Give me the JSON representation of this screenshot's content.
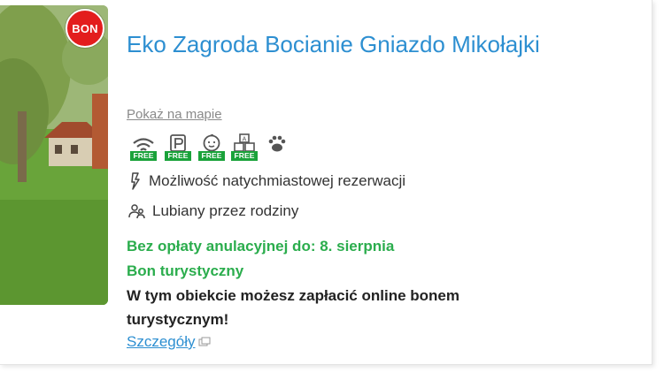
{
  "property": {
    "title": "Eko Zagroda Bocianie Gniazdo Mikołajki",
    "map_link": "Pokaż na mapie",
    "badge": "BON"
  },
  "amenities": [
    {
      "icon": "wifi-icon",
      "label": "FREE"
    },
    {
      "icon": "parking-icon",
      "label": "FREE"
    },
    {
      "icon": "baby-icon",
      "label": "FREE"
    },
    {
      "icon": "toy-blocks-icon",
      "label": "FREE"
    },
    {
      "icon": "paw-icon",
      "label": ""
    }
  ],
  "features": [
    {
      "icon": "lightning-icon",
      "text": "Możliwość natychmiastowej rezerwacji"
    },
    {
      "icon": "family-icon",
      "text": "Lubiany przez rodziny"
    }
  ],
  "offer": {
    "cancellation": "Bez opłaty anulacyjnej do: 8. sierpnia",
    "voucher_title": "Bon turystyczny",
    "voucher_desc": "W tym obiekcie możesz zapłacić online bonem turystycznym!",
    "details_link": "Szczegóły"
  },
  "colors": {
    "title": "#2d8fd1",
    "green": "#2bad4d",
    "badge": "#e31d1d",
    "free": "#1aa23a"
  }
}
